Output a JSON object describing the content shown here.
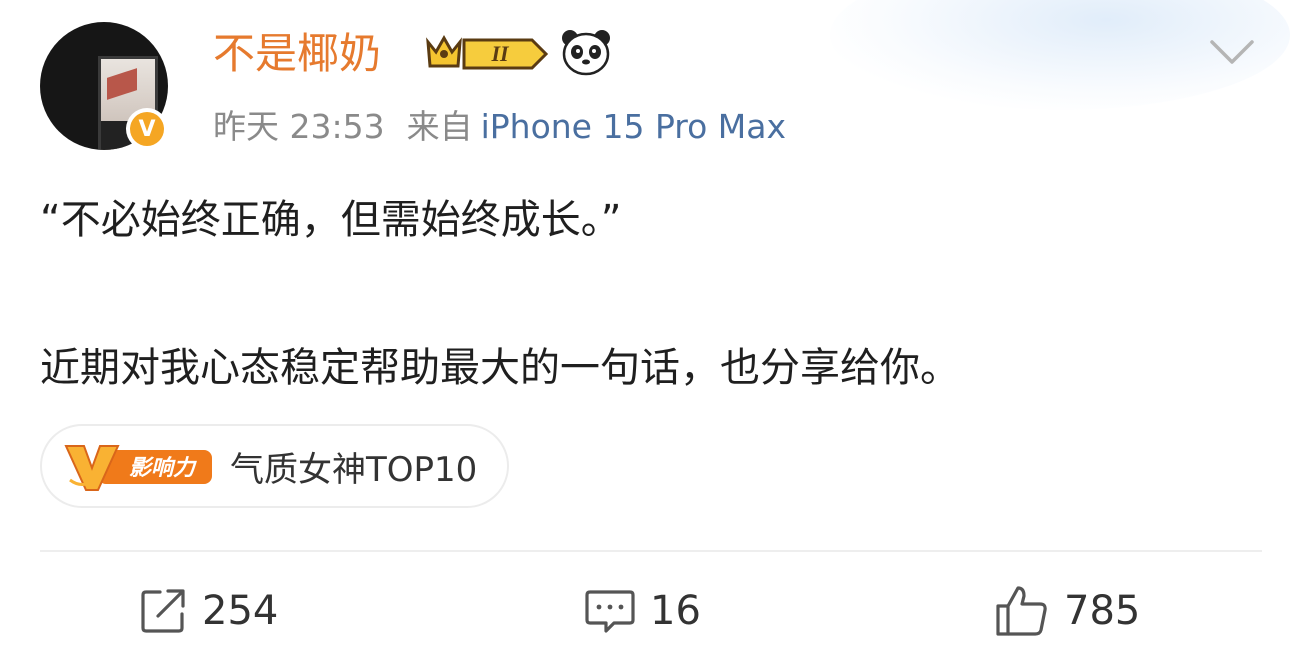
{
  "post": {
    "author": {
      "name": "不是椰奶",
      "vip_level": "II"
    },
    "meta": {
      "time": "昨天 23:53",
      "source_prefix": "来自",
      "device": "iPhone 15 Pro Max"
    },
    "content": {
      "line1": "“不必始终正确，但需始终成长。”",
      "line2": "近期对我心态稳定帮助最大的一句话，也分享给你。"
    },
    "tag": {
      "badge_text": "影响力",
      "label": "气质女神TOP10"
    },
    "actions": {
      "repost_count": "254",
      "comment_count": "16",
      "like_count": "785"
    }
  },
  "colors": {
    "username": "#e67a2e",
    "link": "#4a6fa0",
    "meta_gray": "#8a8a8a",
    "badge_orange": "#f07a1a",
    "verified": "#f5a623"
  },
  "icons": [
    "verified-icon",
    "vip-crown-icon",
    "panda-icon",
    "chevron-down-icon",
    "influence-v-icon",
    "repost-icon",
    "comment-icon",
    "like-icon"
  ]
}
